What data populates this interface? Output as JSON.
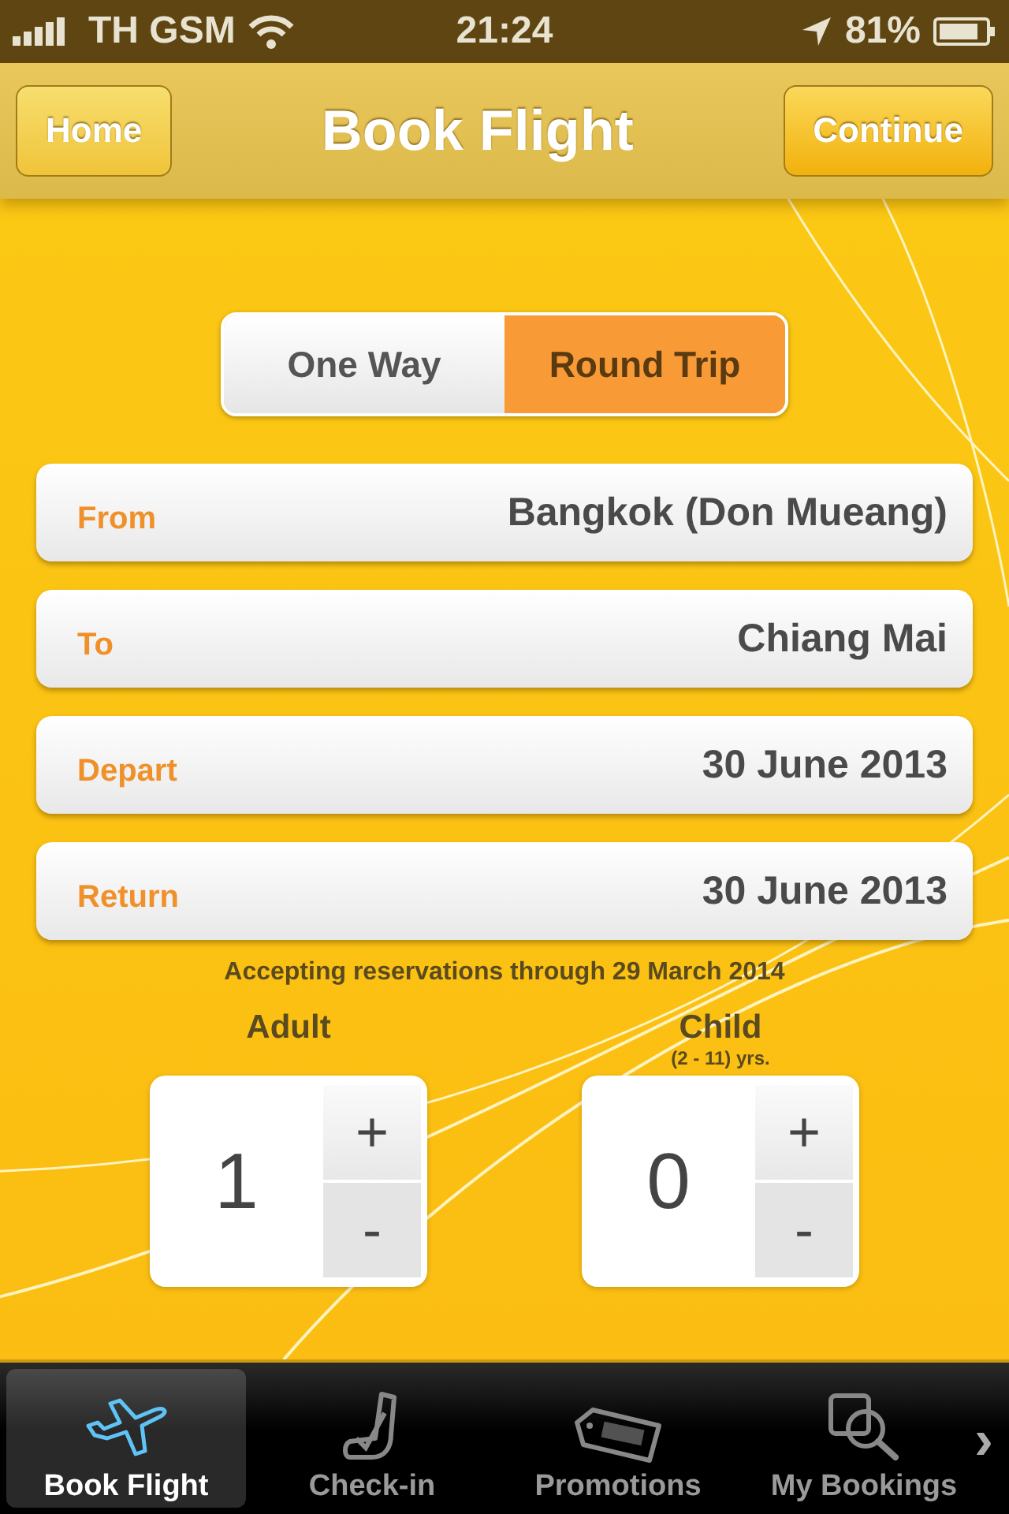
{
  "status_bar": {
    "carrier": "TH GSM",
    "time": "21:24",
    "battery": "81%"
  },
  "nav": {
    "left_button": "Home",
    "title": "Book Flight",
    "right_button": "Continue"
  },
  "trip_type": [
    {
      "label": "One Way",
      "selected": false
    },
    {
      "label": "Round Trip",
      "selected": true
    }
  ],
  "fields": [
    {
      "label": "From",
      "value": "Bangkok (Don Mueang)"
    },
    {
      "label": "To",
      "value": "Chiang Mai"
    },
    {
      "label": "Depart",
      "value": "30 June 2013"
    },
    {
      "label": "Return",
      "value": "30 June 2013"
    }
  ],
  "note": "Accepting reservations through 29 March 2014",
  "passengers": [
    {
      "label": "Adult",
      "count": "1",
      "plus": "+",
      "minus": "-"
    },
    {
      "label": "Child",
      "sublabel": "(2 - 11) yrs.",
      "count": "0",
      "plus": "+",
      "minus": "-"
    }
  ],
  "tab_bar": {
    "items": [
      {
        "label": "Book Flight",
        "selected": true
      },
      {
        "label": "Check-in",
        "selected": false
      },
      {
        "label": "Promotions",
        "selected": false
      },
      {
        "label": "My Bookings",
        "selected": false
      }
    ],
    "more": "›"
  }
}
